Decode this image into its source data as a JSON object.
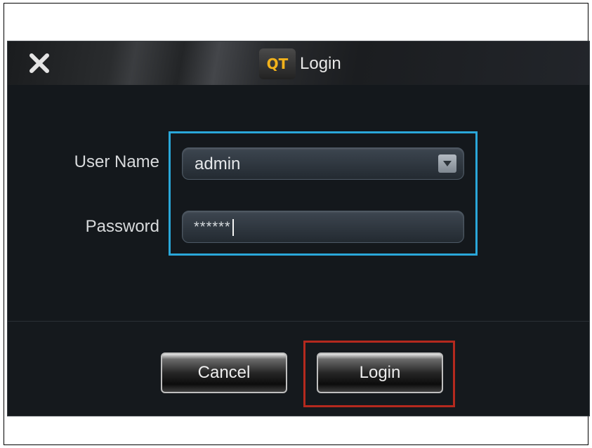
{
  "dialog": {
    "title": "Login",
    "logo_text": "QT",
    "close_icon": "close-icon"
  },
  "form": {
    "username_label": "User Name",
    "username_value": "admin",
    "password_label": "Password",
    "password_value": "******"
  },
  "buttons": {
    "cancel_label": "Cancel",
    "login_label": "Login"
  },
  "colors": {
    "highlight_fields": "#2aa7d9",
    "highlight_login": "#b4291e",
    "logo": "#f2b21b"
  }
}
